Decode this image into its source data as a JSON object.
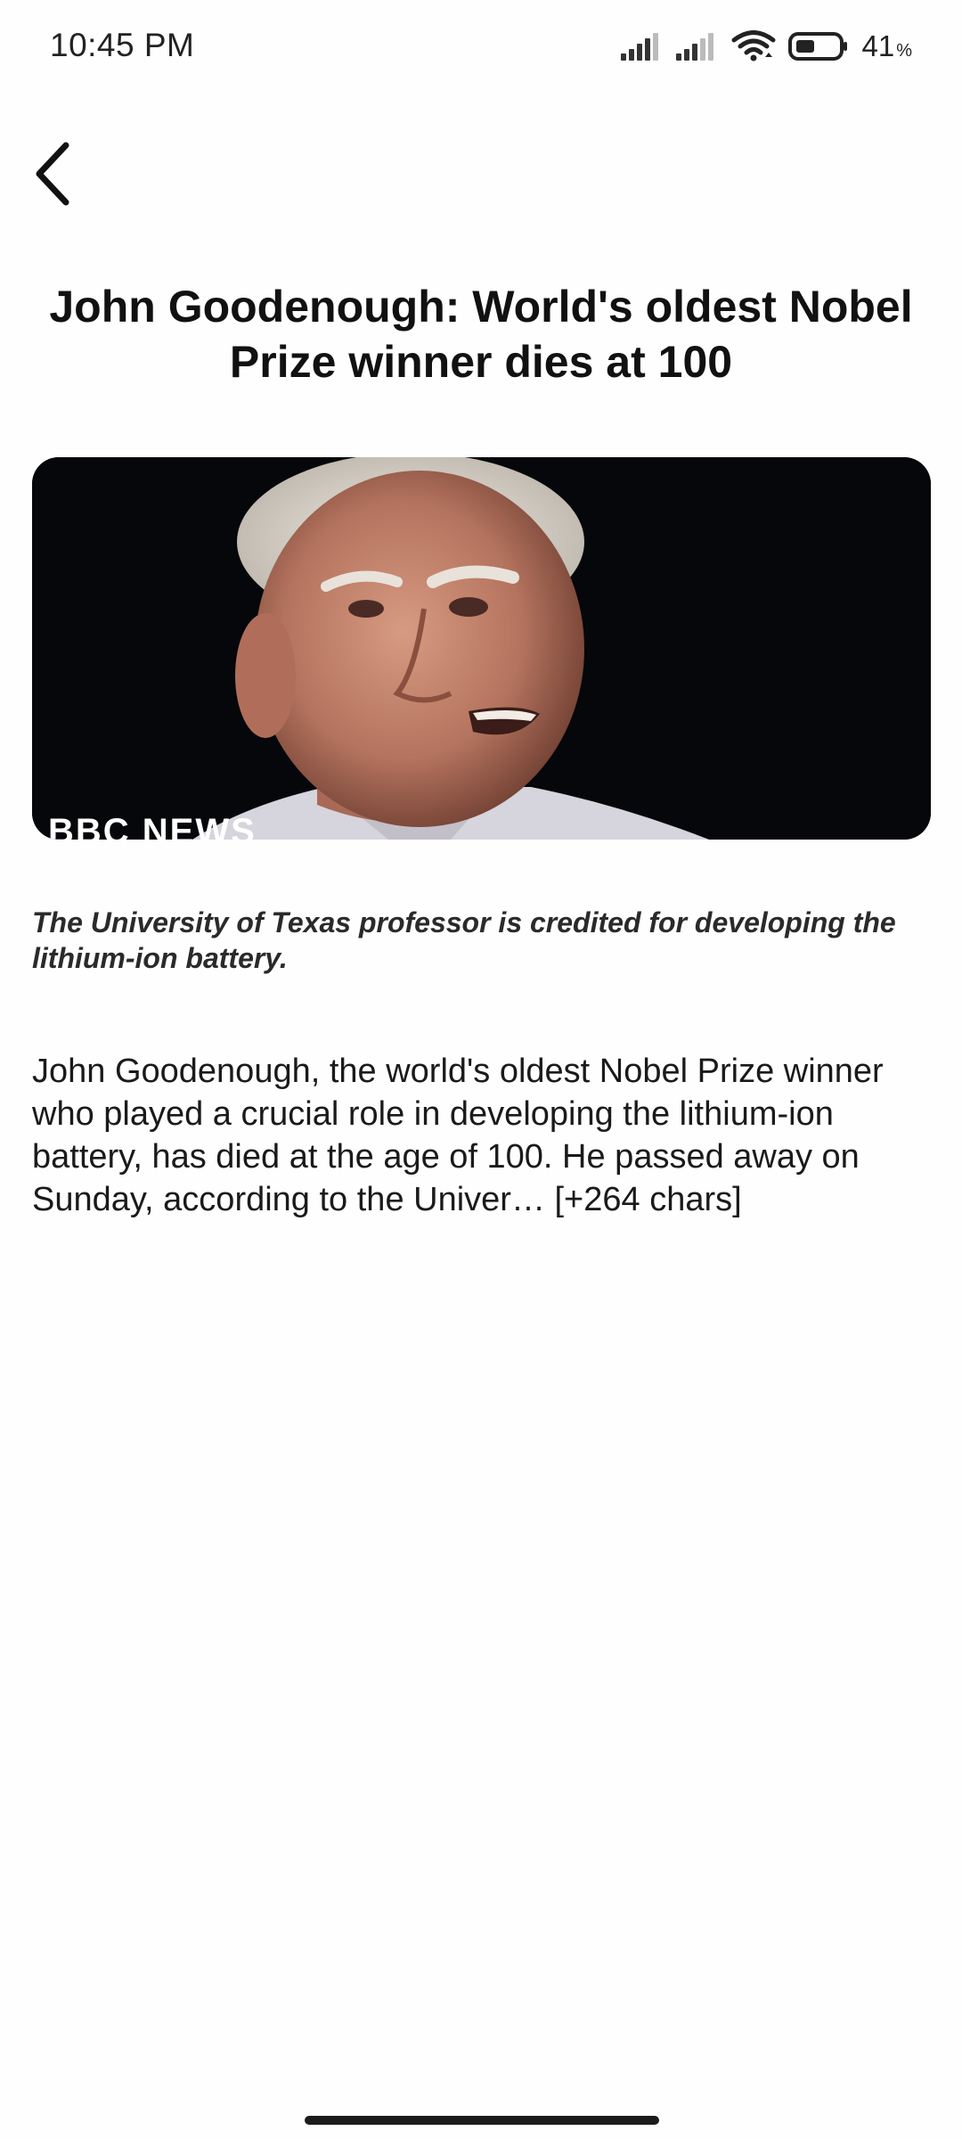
{
  "status_bar": {
    "time": "10:45 PM",
    "battery_level": "41",
    "battery_unit": "%",
    "icons": [
      "signal-icon",
      "signal-icon",
      "wifi-icon",
      "battery-icon"
    ]
  },
  "toolbar": {
    "back_icon": "chevron-left-icon"
  },
  "article": {
    "title": "John Goodenough: World's oldest Nobel Prize winner dies at 100",
    "image_logo_text": "BBC NEWS",
    "description": "The University of Texas professor is credited for developing the lithium-ion battery.",
    "content": "John Goodenough, the world's oldest Nobel Prize winner who played a crucial role in developing the lithium-ion battery, has died at the age of 100. He passed away on Sunday, according to the Univer… [+264 chars]"
  }
}
